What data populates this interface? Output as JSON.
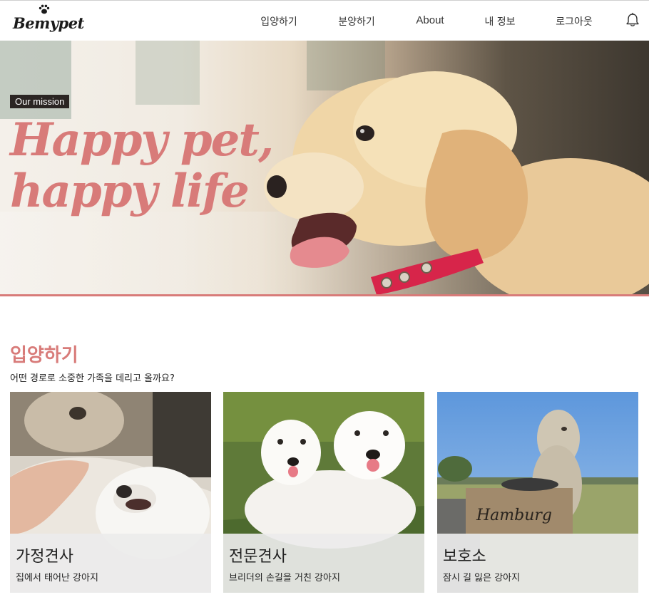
{
  "header": {
    "logo": "Bemypet",
    "nav": [
      {
        "label": "입양하기"
      },
      {
        "label": "분양하기"
      },
      {
        "label": "About"
      },
      {
        "label": "내 정보"
      },
      {
        "label": "로그아웃"
      }
    ],
    "bell_icon": "bell-icon"
  },
  "hero": {
    "tag": "Our mission",
    "title": "Happy pet,\nhappy life",
    "accent_color": "#d87b79"
  },
  "adopt": {
    "title": "입양하기",
    "subtitle": "어떤 경로로 소중한 가족을 데리고 올까요?",
    "cards": [
      {
        "title": "가정견사",
        "desc": "집에서 태어난 강아지"
      },
      {
        "title": "전문견사",
        "desc": "브리더의 손길을 거친 강아지"
      },
      {
        "title": "보호소",
        "desc": "잠시 길 잃은 강아지",
        "sign": "Hamburg"
      }
    ]
  }
}
